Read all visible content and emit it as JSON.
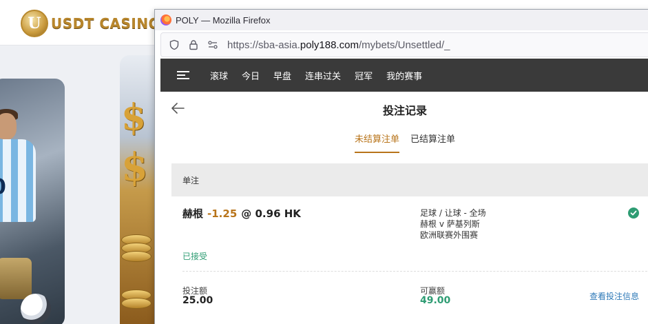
{
  "background_site": {
    "logo_text": "USDT CASINO",
    "logo_letter": "U"
  },
  "browser": {
    "window_title": "POLY — Mozilla Firefox",
    "url_prefix": "https://sba-asia.",
    "url_domain": "poly188.com",
    "url_path": "/mybets/Unsettled/_"
  },
  "nav": {
    "items": [
      "滚球",
      "今日",
      "早盘",
      "连串过关",
      "冠军",
      "我的赛事"
    ]
  },
  "page": {
    "title": "投注记录",
    "tabs": [
      {
        "label": "未结算注单",
        "active": true
      },
      {
        "label": "已结算注单",
        "active": false
      }
    ],
    "section": "单注"
  },
  "bet": {
    "team": "赫根",
    "handicap": "-1.25",
    "at": "@",
    "odds": "0.96 HK",
    "market": "足球 / 让球 - 全场",
    "match": "赫根 v 萨基列斯",
    "league": "欧洲联赛外围赛",
    "status": "已接受",
    "stake_label": "投注额",
    "stake": "25.00",
    "win_label": "可赢额",
    "win": "49.00",
    "details_link": "查看投注信息"
  },
  "colors": {
    "accent": "#b8741a",
    "success": "#2e9c73",
    "link": "#2f7ab8",
    "nav_bg": "#3a3a3a"
  }
}
